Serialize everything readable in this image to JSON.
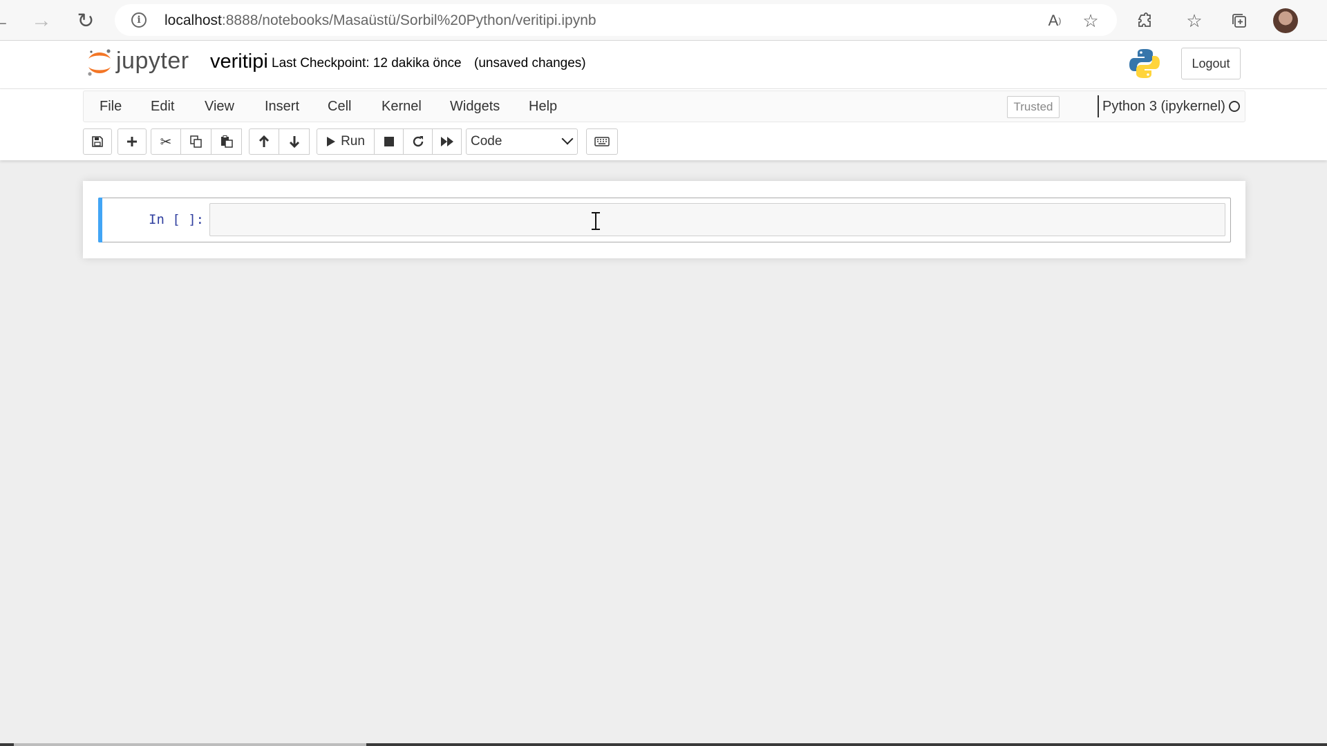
{
  "browser": {
    "url_host": "localhost",
    "url_rest": ":8888/notebooks/Masaüstü/Sorbil%20Python/veritipi.ipynb",
    "icons": [
      "back-icon",
      "forward-icon",
      "refresh-icon",
      "site-info-icon",
      "read-aloud-icon",
      "add-favorite-icon",
      "extensions-icon",
      "favorites-icon",
      "collections-icon",
      "profile-avatar"
    ]
  },
  "header": {
    "logo_text": "jupyter",
    "notebook_name": "veritipi",
    "checkpoint": "Last Checkpoint: 12 dakika önce",
    "status": "(unsaved changes)",
    "logout_label": "Logout"
  },
  "menubar": {
    "items": [
      "File",
      "Edit",
      "View",
      "Insert",
      "Cell",
      "Kernel",
      "Widgets",
      "Help"
    ],
    "trusted_label": "Trusted",
    "kernel_name": "Python 3 (ipykernel)"
  },
  "toolbar": {
    "run_label": "Run",
    "cell_type": "Code",
    "icons": [
      "save-icon",
      "add-cell-icon",
      "cut-icon",
      "copy-icon",
      "paste-icon",
      "move-up-icon",
      "move-down-icon",
      "run-icon",
      "interrupt-icon",
      "restart-icon",
      "restart-run-all-icon",
      "keyboard-icon"
    ]
  },
  "notebook": {
    "cells": [
      {
        "prompt": "In [ ]:",
        "source": ""
      }
    ]
  },
  "colors": {
    "jupyter_orange": "#f37626",
    "cell_selected_bar": "#42a5f5",
    "prompt_blue": "#303f9f"
  }
}
